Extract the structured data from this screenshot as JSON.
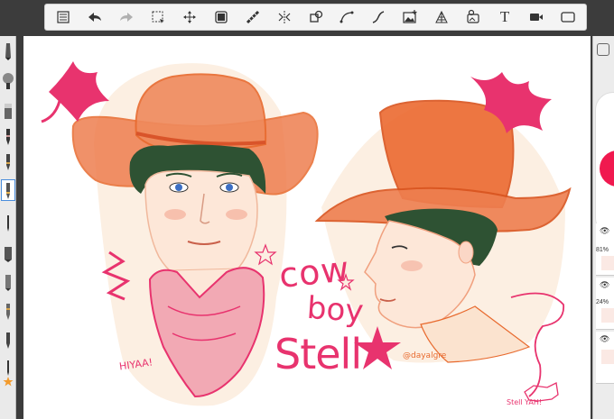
{
  "toolbar": {
    "buttons": [
      {
        "name": "layers-list-icon"
      },
      {
        "name": "undo-icon"
      },
      {
        "name": "redo-icon"
      },
      {
        "name": "select-icon"
      },
      {
        "name": "transform-icon"
      },
      {
        "name": "layer-icon"
      },
      {
        "name": "ruler-icon"
      },
      {
        "name": "symmetry-icon"
      },
      {
        "name": "shape-icon"
      },
      {
        "name": "curve-icon"
      },
      {
        "name": "stroke-icon"
      },
      {
        "name": "image-icon"
      },
      {
        "name": "perspective-icon"
      },
      {
        "name": "stamp-icon"
      },
      {
        "name": "text-icon"
      },
      {
        "name": "video-icon"
      },
      {
        "name": "fullscreen-icon"
      }
    ],
    "text_glyph": "T"
  },
  "canvas": {
    "lettering": {
      "line1": "cow",
      "line2": "boy",
      "line3": "Stell",
      "yell": "HIYAA!",
      "signature": "@dayalgre",
      "small_note": "Stell YAH!"
    },
    "colors": {
      "orange": "#f07a3a",
      "pink": "#e8336e",
      "skin": "#fcefe2",
      "hat": "#ee7e4f",
      "hair": "#2e5233"
    }
  },
  "layers": [
    {
      "opacity": "81%"
    },
    {
      "opacity": "24%"
    },
    {
      "opacity": ""
    }
  ],
  "color_indicator": "#f0194f"
}
